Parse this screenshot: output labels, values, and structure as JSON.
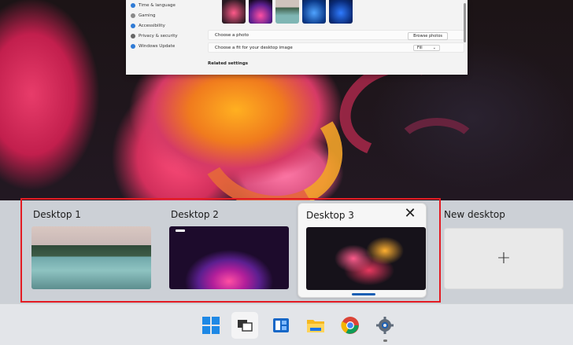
{
  "settings_window": {
    "nav_items": [
      {
        "label": "Time & language",
        "icon": "globe-clock-icon",
        "color": "#2f7bd6"
      },
      {
        "label": "Gaming",
        "icon": "gamepad-icon",
        "color": "#888888"
      },
      {
        "label": "Accessibility",
        "icon": "accessibility-icon",
        "color": "#2f7bd6"
      },
      {
        "label": "Privacy & security",
        "icon": "shield-icon",
        "color": "#666666"
      },
      {
        "label": "Windows Update",
        "icon": "windows-update-icon",
        "color": "#2f7bd6"
      }
    ],
    "choose_photo_label": "Choose a photo",
    "browse_photos_label": "Browse photos",
    "choose_fit_label": "Choose a fit for your desktop image",
    "fit_value": "Fill",
    "related_settings_label": "Related settings"
  },
  "desktops": [
    {
      "label": "Desktop 1",
      "thumb": "lake-landscape",
      "active": false
    },
    {
      "label": "Desktop 2",
      "thumb": "purple-glow",
      "active": false
    },
    {
      "label": "Desktop 3",
      "thumb": "abstract-bloom",
      "active": true
    }
  ],
  "new_desktop": {
    "label": "New desktop",
    "icon": "plus-icon"
  },
  "close_glyph": "✕",
  "plus_glyph": "+",
  "colors": {
    "highlight": "#e31b23",
    "accent": "#1a5fb4"
  },
  "taskbar": {
    "apps": [
      {
        "name": "start",
        "icon": "windows-logo-icon"
      },
      {
        "name": "task-view",
        "icon": "task-view-icon",
        "active": true
      },
      {
        "name": "widgets",
        "icon": "widgets-icon"
      },
      {
        "name": "file-explorer",
        "icon": "folder-icon"
      },
      {
        "name": "chrome",
        "icon": "chrome-icon"
      },
      {
        "name": "settings",
        "icon": "gear-icon",
        "running": true
      }
    ]
  }
}
